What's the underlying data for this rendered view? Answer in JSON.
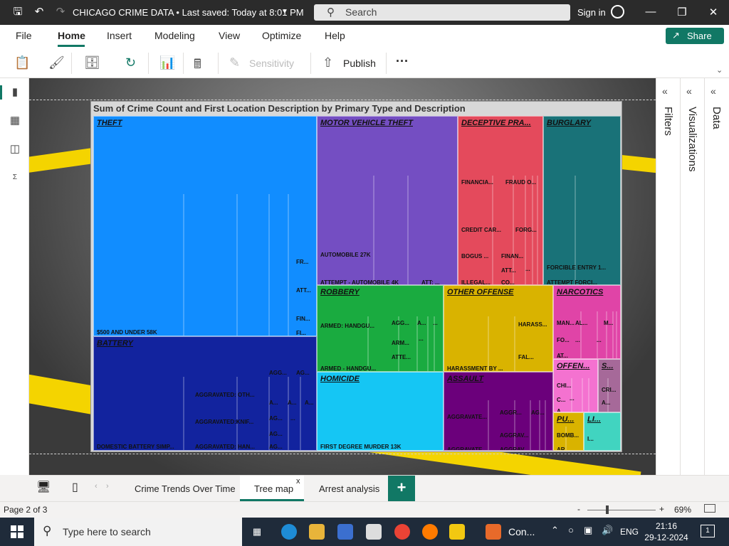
{
  "window": {
    "title": "CHICAGO CRIME DATA • Last saved: Today at 8:01 PM",
    "search_placeholder": "Search",
    "sign_in": "Sign in"
  },
  "menu": {
    "tabs": [
      "File",
      "Home",
      "Insert",
      "Modeling",
      "View",
      "Optimize",
      "Help"
    ],
    "active": "Home",
    "share": "Share"
  },
  "ribbon": {
    "sensitivity": "Sensitivity",
    "publish": "Publish",
    "more": "···"
  },
  "panes": {
    "filters": "Filters",
    "visualizations": "Visualizations",
    "data": "Data"
  },
  "visual": {
    "title": "Sum of Crime Count and First Location Description by Primary Type and Description"
  },
  "chart_data": {
    "type": "treemap",
    "title": "Sum of Crime Count and First Location Description by Primary Type and Description",
    "groups": [
      {
        "name": "THEFT",
        "color": "#118dff",
        "labels": [
          "$500 AND UNDER 58K",
          "FR...",
          "ATT...",
          "FIN...",
          "FI..."
        ]
      },
      {
        "name": "MOTOR VEHICLE THEFT",
        "color": "#744ec2",
        "labels": [
          "AUTOMOBILE 27K",
          "ATTEMPT - AUTOMOBILE 4K",
          "ATT: ..."
        ]
      },
      {
        "name": "DECEPTIVE PRA...",
        "color": "#e44a5c",
        "labels": [
          "FINANCIA...",
          "FRAUD O...",
          "CREDIT CAR...",
          "FORG...",
          "BOGUS ...",
          "FINAN...",
          "ATT...",
          "...",
          "ILLEGAL...",
          "CO..."
        ]
      },
      {
        "name": "BURGLARY",
        "color": "#197278",
        "labels": [
          "FORCIBLE ENTRY 1...",
          "ATTEMPT FORCI..."
        ]
      },
      {
        "name": "BATTERY",
        "color": "#12239e",
        "labels": [
          "DOMESTIC BATTERY SIMP...",
          "AGGRAVATED: OTH...",
          "AGGRAVATED:KNIF...",
          "AGGRAVATED: HAN...",
          "AGG...",
          "AG...",
          "A...",
          "A...",
          "A...",
          "AG...",
          "AG...",
          "...",
          "AG..."
        ]
      },
      {
        "name": "ROBBERY",
        "color": "#1aab40",
        "labels": [
          "ARMED: HANDGU...",
          "ARMED - HANDGU...",
          "AGG...",
          "A...",
          "...",
          "ARM...",
          "...",
          "ATTE..."
        ]
      },
      {
        "name": "OTHER OFFENSE",
        "color": "#d9b300",
        "labels": [
          "HARASSMENT BY ...",
          "HARASS...",
          "FAL..."
        ]
      },
      {
        "name": "NARCOTICS",
        "color": "#e044a7",
        "labels": [
          "MAN...",
          "FO...",
          "...",
          "AL...",
          "M...",
          "...",
          "...",
          "AT...",
          "M..."
        ]
      },
      {
        "name": "HOMICIDE",
        "color": "#15c6f4",
        "labels": [
          "FIRST DEGREE MURDER 13K"
        ]
      },
      {
        "name": "ASSAULT",
        "color": "#6b007b",
        "labels": [
          "AGGRAVATE...",
          "AGGR...",
          "AG...",
          "AGGRAV...",
          "AGGRAVATE...",
          "AGGRAV..."
        ]
      },
      {
        "name": "OFFEN...",
        "color": "#f472d0",
        "labels": [
          "CHI...",
          "C...",
          "...",
          "A..."
        ]
      },
      {
        "name": "S...",
        "color": "#a66999",
        "labels": [
          "CRI...",
          "A..."
        ]
      },
      {
        "name": "PU...",
        "color": "#d9b300",
        "labels": [
          "BOMB...",
          "AR..."
        ]
      },
      {
        "name": "LI...",
        "color": "#41d4c0",
        "labels": [
          "I..."
        ]
      }
    ]
  },
  "pages": {
    "tabs": [
      "Crime Trends Over Time",
      "Tree map",
      "Arrest analysis"
    ],
    "active": "Tree map",
    "close": "x",
    "add": "+"
  },
  "status": {
    "page": "Page 2 of 3",
    "zoom": "69%",
    "zoom_minus": "-",
    "zoom_plus": "+"
  },
  "taskbar": {
    "search_placeholder": "Type here to search",
    "app_label": "Con...",
    "lang": "ENG",
    "time": "21:16",
    "date": "29-12-2024",
    "notifications": "1"
  }
}
